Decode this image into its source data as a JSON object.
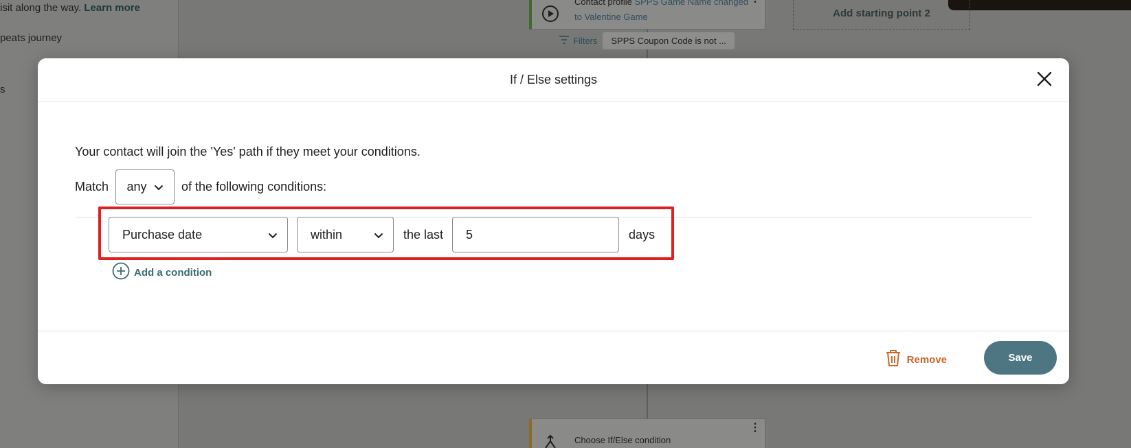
{
  "background": {
    "left_panel": {
      "line1_text": "isit along the way.",
      "line1_link": "Learn more",
      "line2": "peats journey",
      "line3": "s"
    },
    "top_node": {
      "line1_prefix": "Contact profile",
      "line1_highlight": "SPPS Game Name changed",
      "line2": "to Valentine Game"
    },
    "filters": {
      "label": "Filters",
      "chip": "SPPS Coupon Code is not ..."
    },
    "start_point": "Add starting point 2",
    "bottom_node": {
      "label": "Choose If/Else condition"
    }
  },
  "modal": {
    "title": "If / Else settings",
    "intro": "Your contact will join the 'Yes' path if they meet your conditions.",
    "match_prefix": "Match",
    "match_value": "any",
    "match_suffix": "of the following conditions:",
    "condition": {
      "field": "Purchase date",
      "operator": "within",
      "connector": "the last",
      "value": "5",
      "unit": "days"
    },
    "add_condition": "Add a condition",
    "remove_label": "Remove",
    "save_label": "Save"
  },
  "icons": {
    "close": "close-icon",
    "chevron": "chevron-down-icon",
    "add": "plus-circle-icon",
    "trash": "trash-icon",
    "filter": "filter-icon",
    "play": "play-icon",
    "split": "split-icon"
  },
  "colors": {
    "accent": "#4d7682",
    "remove": "#c9662a",
    "highlight": "#e02020",
    "link": "#3a6a75"
  }
}
